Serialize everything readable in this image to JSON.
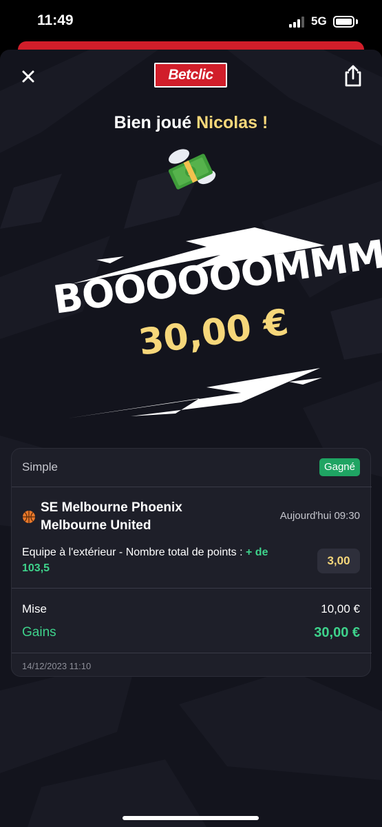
{
  "status_bar": {
    "time": "11:49",
    "network": "5G",
    "signal_bars_active": 3,
    "signal_bars_total": 4,
    "battery_level": 1.0
  },
  "header": {
    "logo_text": "Betclic",
    "close_icon": "close-icon",
    "share_icon": "share-icon",
    "brand_color": "#d11e2a"
  },
  "celebration": {
    "greeting_prefix": "Bien joué ",
    "greeting_name": "Nicolas !",
    "emoji_icon": "money-with-wings-icon",
    "boom_text": "BOOOOOOMMMMM",
    "boom_amount": "30,00 €",
    "accent_color": "#f6d77a"
  },
  "bet": {
    "type": "Simple",
    "status": "Gagné",
    "status_color": "#1fa463",
    "sport_icon": "basketball-icon",
    "team_home": "SE Melbourne Phoenix",
    "team_away": "Melbourne United",
    "match_time": "Aujourd'hui 09:30",
    "market_text": "Equipe à l'extérieur - Nombre total de points : ",
    "selection": "+ de 103,5",
    "odds": "3,00",
    "stake_label": "Mise",
    "stake_value": "10,00 €",
    "gains_label": "Gains",
    "gains_value": "30,00 €",
    "placed_at": "14/12/2023 11:10"
  }
}
